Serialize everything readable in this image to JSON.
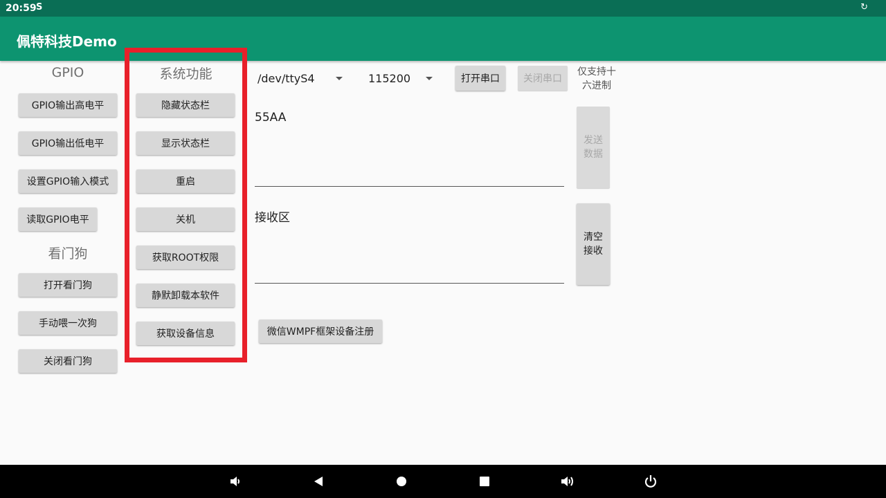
{
  "statusbar": {
    "time": "20:59",
    "left_icon": "S",
    "right_icon": "↻"
  },
  "appbar": {
    "title": "佩特科技Demo"
  },
  "gpio": {
    "title": "GPIO",
    "buttons": [
      "GPIO输出高电平",
      "GPIO输出低电平",
      "设置GPIO输入模式",
      "读取GPIO电平"
    ]
  },
  "watchdog": {
    "title": "看门狗",
    "buttons": [
      "打开看门狗",
      "手动喂一次狗",
      "关闭看门狗"
    ]
  },
  "system": {
    "title": "系统功能",
    "buttons": [
      "隐藏状态栏",
      "显示状态栏",
      "重启",
      "关机",
      "获取ROOT权限",
      "静默卸载本软件",
      "获取设备信息"
    ]
  },
  "serial": {
    "port": "/dev/ttyS4",
    "baud": "115200",
    "open_label": "打开串口",
    "close_label": "关闭串口",
    "hex_note": "仅支持十六进制",
    "send_value": "55AA",
    "send_label": [
      "发送",
      "数据"
    ],
    "recv_hint": "接收区",
    "clear_label": [
      "清空",
      "接收"
    ],
    "wmpf_label": "微信WMPF框架设备注册"
  },
  "nav": {
    "icons": [
      "volume-down-icon",
      "back-icon",
      "home-icon",
      "recents-icon",
      "volume-up-icon",
      "power-icon"
    ]
  },
  "colors": {
    "statusbar": "#0a6e55",
    "appbar": "#0d9470",
    "highlight": "#e8202a"
  }
}
